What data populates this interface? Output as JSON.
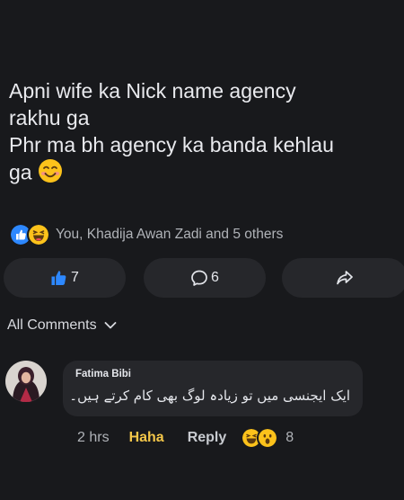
{
  "post": {
    "text_line1": "Apni wife ka Nick name agency",
    "text_line2": "rakhu ga",
    "text_line3": "Phr ma bh agency ka banda kehlau",
    "text_line4": "ga",
    "inline_emoji": "smiling-blush-emoji"
  },
  "reactions": {
    "icons": [
      "like-icon",
      "haha-icon"
    ],
    "summary": "You, Khadija Awan Zadi and 5 others"
  },
  "actions": {
    "like_count": "7",
    "comment_count": "6",
    "share_icon": "share-arrow-icon",
    "accent": "#2d88ff"
  },
  "comments_header": {
    "label": "All Comments"
  },
  "comment": {
    "author": "Fatima Bibi",
    "body": "ایک ایجنسی میں تو زیادہ لوگ بھی کام کرتے ہیں۔",
    "time": "2 hrs",
    "haha_label": "Haha",
    "reply_label": "Reply",
    "reaction_icons": [
      "haha-icon",
      "wow-icon"
    ],
    "reaction_count": "8",
    "haha_color": "#f3c649"
  }
}
